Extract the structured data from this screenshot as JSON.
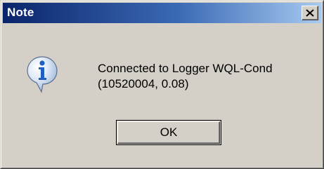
{
  "window": {
    "title": "Note"
  },
  "titlebar": {
    "close_icon": "close-icon",
    "gradient_start": "#0a246a",
    "gradient_end": "#a6caf0"
  },
  "content": {
    "icon": "information-icon",
    "message_line1": "Connected to Logger WQL-Cond",
    "message_line2": "(10520004, 0.08)"
  },
  "buttons": {
    "ok_label": "OK"
  },
  "colors": {
    "face": "#d4d0c8",
    "info_blue": "#1f5fbf"
  }
}
